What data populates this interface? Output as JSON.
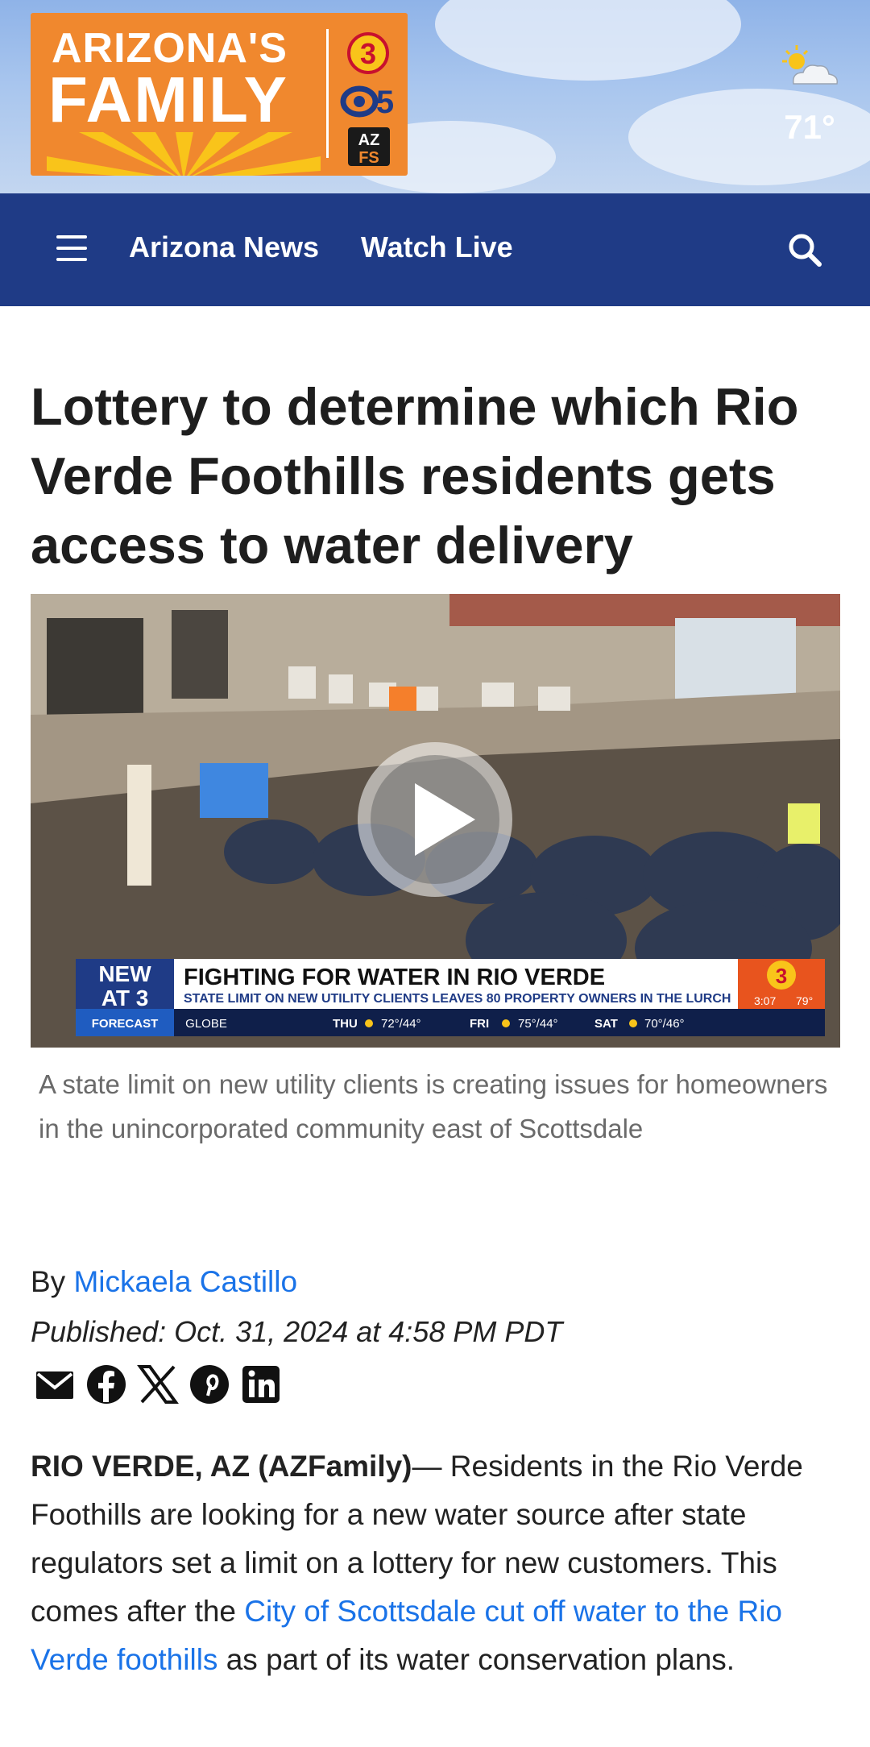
{
  "brand": {
    "logo_line1": "ARIZONA'S",
    "logo_line2": "FAMILY",
    "badge_top": "3",
    "badge_mid": "5",
    "badge_bottom": "AZFS",
    "brand_color": "#f0882e"
  },
  "weather": {
    "temp": "71°",
    "icon": "partly-sunny-icon"
  },
  "nav": {
    "items": [
      "Arizona News",
      "Watch Live"
    ],
    "background": "#1f3b86",
    "menu_icon": "hamburger-menu-icon",
    "search_icon": "search-icon"
  },
  "article": {
    "headline": "Lottery to determine which Rio Verde Foothills residents gets access to water delivery",
    "video": {
      "lower_third_tag_line1": "NEW",
      "lower_third_tag_line2": "AT 3",
      "lower_third_headline": "FIGHTING FOR WATER IN RIO VERDE",
      "lower_third_sub": "STATE LIMIT ON NEW UTILITY CLIENTS LEAVES 80 PROPERTY OWNERS IN THE LURCH",
      "time": "3:07",
      "temp": "79°",
      "ticker_label": "FORECAST",
      "ticker_city": "GLOBE",
      "ticker_days": [
        {
          "day": "THU",
          "temps": "72°/44°"
        },
        {
          "day": "FRI",
          "temps": "75°/44°"
        },
        {
          "day": "SAT",
          "temps": "70°/46°"
        }
      ],
      "play_icon": "play-icon"
    },
    "caption": "A state limit on new utility clients is creating issues for homeowners in the unincorporated community east of Scottsdale",
    "byline_prefix": "By",
    "author": "Mickaela Castillo",
    "published": "Published: Oct. 31, 2024 at 4:58 PM PDT",
    "share_icons": [
      "email-icon",
      "facebook-icon",
      "x-icon",
      "pinterest-icon",
      "linkedin-icon"
    ],
    "dateline": "RIO VERDE, AZ (AZFamily)",
    "body_1": "— Residents in the Rio Verde Foothills are looking for a new water source after state regulators set a limit on a lottery for new customers. This comes after the ",
    "body_link": "City of Scottsdale cut off water to the Rio Verde foothills",
    "body_2": " as part of its water conservation plans.",
    "link_color": "#1a73e8"
  }
}
